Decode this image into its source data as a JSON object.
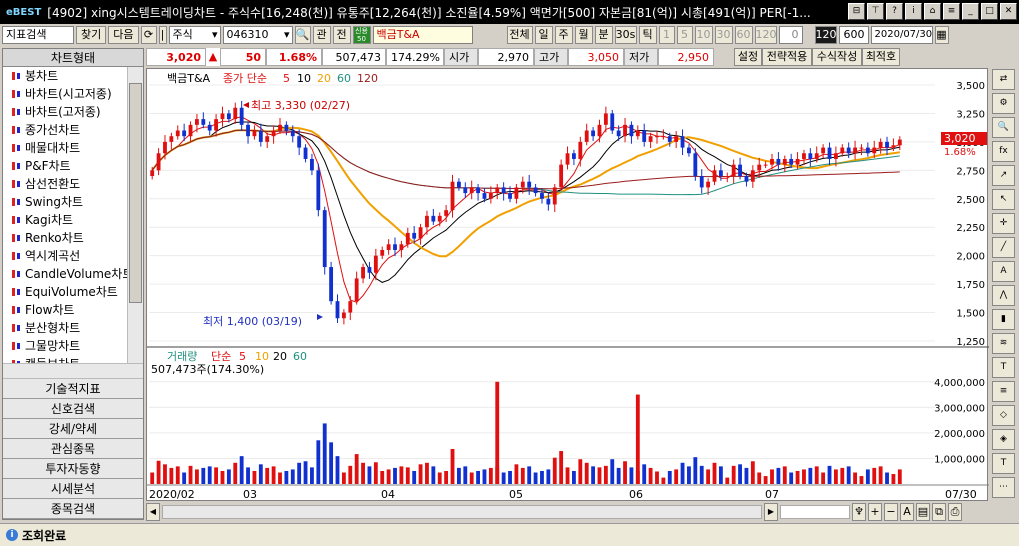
{
  "window": {
    "logo": "eBEST",
    "title": "[4902] xing시스템트레이딩차트 - 주식수[16,248(천)] 유통주[12,264(천)] 소진율[4.59%] 액면가[500] 자본금[81(억)] 시총[491(억)] PER[-1..."
  },
  "toolbar": {
    "indicator_search": "지표검색",
    "find": "찾기",
    "next": "다음",
    "market": "주식",
    "code": "046310",
    "name": "백금T&A",
    "all_btn": "전체",
    "periods": [
      "일",
      "주",
      "월",
      "분",
      "30s",
      "틱"
    ],
    "intervals": [
      "1",
      "5",
      "10",
      "30",
      "60",
      "120"
    ],
    "stepper_value": "0",
    "count_sel": "120",
    "count": "600",
    "date": "2020/07/30"
  },
  "infobar": {
    "price": "3,020",
    "change": "50",
    "change_pct": "1.68%",
    "volume": "507,473",
    "volume_pct": "174.29%",
    "open_label": "시가",
    "open": "2,970",
    "high_label": "고가",
    "high": "3,050",
    "low_label": "저가",
    "low": "2,950",
    "settings": "설정",
    "apply_strategy": "전략적용",
    "formula": "수식작성",
    "optimize": "최적호"
  },
  "sidebar": {
    "header": "차트형태",
    "items": [
      "봉차트",
      "바차트(시고저종)",
      "바차트(고저종)",
      "종가선차트",
      "매물대차트",
      "P&F차트",
      "삼선전환도",
      "Swing차트",
      "Kagi차트",
      "Renko차트",
      "역시계곡선",
      "CandleVolume차트",
      "EquiVolume차트",
      "Flow차트",
      "분산형차트",
      "그물망차트",
      "캔들보차트"
    ],
    "menus": [
      "기술적지표",
      "신호검색",
      "강세/약세",
      "관심종목",
      "투자자동향",
      "시세분석",
      "종목검색"
    ]
  },
  "price_panel": {
    "legend_name": "백금T&A",
    "legend_ma": "종가 단순",
    "ma_periods": [
      "5",
      "10",
      "20",
      "60",
      "120"
    ],
    "high_annotation": "최고 3,330 (02/27)",
    "low_annotation": "최저 1,400 (03/19)",
    "current_tag": "3,020",
    "pct_tag": "1.68%",
    "yticks": [
      "3,500",
      "3,250",
      "3,000",
      "2,750",
      "2,500",
      "2,250",
      "2,000",
      "1,750",
      "1,500",
      "1,250"
    ]
  },
  "volume_panel": {
    "legend_name": "거래량",
    "legend_ma": "단순",
    "ma_periods": [
      "5",
      "10",
      "20",
      "60"
    ],
    "readout": "507,473주(174.30%)",
    "yticks": [
      "4,000,000",
      "3,000,000",
      "2,000,000",
      "1,000,000"
    ]
  },
  "xaxis": {
    "labels": [
      "2020/02",
      "03",
      "04",
      "05",
      "06",
      "07"
    ],
    "end_label": "07/30"
  },
  "colors": {
    "up": "#e01010",
    "down": "#1030d0",
    "ma5": "#e01010",
    "ma10": "#000000",
    "ma20": "#f0a000",
    "ma60": "#209080",
    "ma120": "#9b1c1c"
  },
  "status": {
    "text": "조회완료"
  },
  "chart_data": {
    "type": "candlestick",
    "x_range": [
      "2020/02",
      "2020/07/30"
    ],
    "ylim": [
      1250,
      3500
    ],
    "high": {
      "value": 3330,
      "date": "02/27"
    },
    "low": {
      "value": 1400,
      "date": "03/19"
    },
    "last": {
      "open": 2970,
      "high": 3050,
      "low": 2950,
      "close": 3020,
      "change": 50,
      "change_pct": 1.68,
      "volume": 507473
    },
    "closes": [
      2750,
      2900,
      3000,
      3050,
      3100,
      3050,
      3150,
      3200,
      3150,
      3100,
      3200,
      3250,
      3200,
      3300,
      3150,
      3050,
      3100,
      3000,
      3050,
      3100,
      3150,
      3100,
      3050,
      2950,
      2850,
      2750,
      2400,
      1900,
      1600,
      1450,
      1500,
      1600,
      1800,
      1900,
      1850,
      2000,
      2050,
      2100,
      2050,
      2100,
      2200,
      2150,
      2250,
      2350,
      2300,
      2350,
      2400,
      2650,
      2600,
      2550,
      2600,
      2550,
      2500,
      2550,
      2600,
      2550,
      2500,
      2600,
      2650,
      2600,
      2550,
      2500,
      2450,
      2600,
      2800,
      2900,
      2850,
      3000,
      3100,
      3050,
      3150,
      3250,
      3100,
      3050,
      3150,
      3050,
      3100,
      3000,
      3050,
      3050,
      3050,
      3000,
      3050,
      2950,
      2900,
      2700,
      2600,
      2650,
      2750,
      2700,
      2700,
      2800,
      2700,
      2650,
      2750,
      2800,
      2800,
      2850,
      2800,
      2850,
      2800,
      2850,
      2900,
      2850,
      2900,
      2950,
      2850,
      2900,
      2950,
      2900,
      2950,
      2950,
      2900,
      2950,
      3000,
      2950,
      2970,
      3020
    ],
    "volume_ylim": [
      0,
      4500000
    ],
    "volume_peaks": [
      {
        "date": "2020/04",
        "value": 4000000
      },
      {
        "date": "2020/05",
        "value": 3500000
      }
    ]
  }
}
